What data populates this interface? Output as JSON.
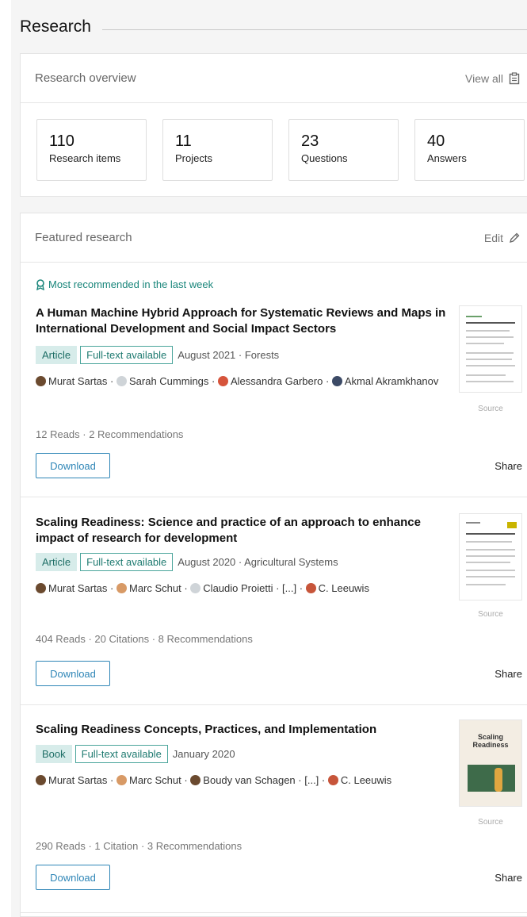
{
  "page": {
    "title": "Research"
  },
  "overview": {
    "title": "Research overview",
    "view_all": "View all",
    "stats": [
      {
        "value": "110",
        "label": "Research items"
      },
      {
        "value": "11",
        "label": "Projects"
      },
      {
        "value": "23",
        "label": "Questions"
      },
      {
        "value": "40",
        "label": "Answers"
      }
    ]
  },
  "featured": {
    "title": "Featured research",
    "edit": "Edit",
    "banner": "Most recommended in the last week",
    "items": [
      {
        "title": "A Human Machine Hybrid Approach for Systematic Reviews and Maps in International Development and Social Impact Sectors",
        "type": "Article",
        "availability": "Full-text available",
        "meta": "August 2021 · Forests",
        "authors": [
          "Murat Sartas",
          "Sarah Cummings",
          "Alessandra Garbero",
          "Akmal Akramkhanov"
        ],
        "stats": "12 Reads · 2 Recommendations",
        "download": "Download",
        "share": "Share",
        "source": "Source"
      },
      {
        "title": "Scaling Readiness: Science and practice of an approach to enhance impact of research for development",
        "type": "Article",
        "availability": "Full-text available",
        "meta": "August 2020 · Agricultural Systems",
        "authors": [
          "Murat Sartas",
          "Marc Schut",
          "Claudio Proietti",
          "[...]",
          "C. Leeuwis"
        ],
        "stats": "404 Reads · 20 Citations · 8 Recommendations",
        "download": "Download",
        "share": "Share",
        "source": "Source"
      },
      {
        "title": "Scaling Readiness Concepts, Practices, and Implementation",
        "type": "Book",
        "availability": "Full-text available",
        "meta": "January 2020",
        "authors": [
          "Murat Sartas",
          "Marc Schut",
          "Boudy van Schagen",
          "[...]",
          "C. Leeuwis"
        ],
        "stats": "290 Reads · 1 Citation · 3 Recommendations",
        "download": "Download",
        "share": "Share",
        "source": "Source",
        "cover_title": "Scaling Readiness"
      }
    ]
  },
  "colors": {
    "accent": "#18857a",
    "link": "#2f86b7",
    "tag_bg": "#d7ecea"
  }
}
